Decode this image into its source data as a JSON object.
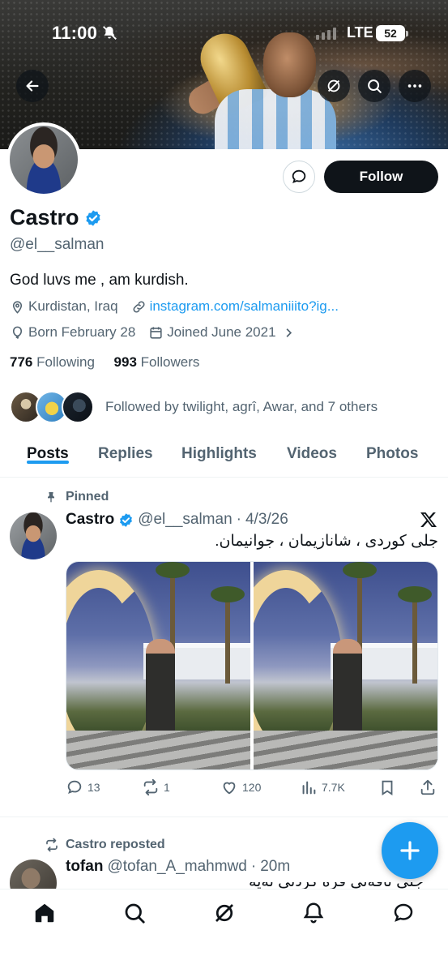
{
  "status_bar": {
    "time": "11:00",
    "network": "LTE",
    "battery": "52"
  },
  "profile": {
    "name": "Castro",
    "handle": "@el__salman",
    "bio": "God luvs me , am kurdish.",
    "location": "Kurdistan, Iraq",
    "link": "instagram.com/salmaniiito?ig...",
    "birthday": "Born February 28",
    "joined": "Joined June 2021",
    "following_count": "776",
    "following_label": "Following",
    "followers_count": "993",
    "followers_label": "Followers",
    "followed_by": "Followed by twilight, agrî, Awar, and 7 others",
    "follow_label": "Follow"
  },
  "tabs": [
    {
      "label": "Posts",
      "active": true
    },
    {
      "label": "Replies"
    },
    {
      "label": "Highlights"
    },
    {
      "label": "Videos"
    },
    {
      "label": "Photos"
    }
  ],
  "pinned_post": {
    "pinned_label": "Pinned",
    "name": "Castro",
    "handle": "@el__salman",
    "sep": "·",
    "date": "4/3/26",
    "text": "جلی کوردی ، شانازیمان ، جوانیمان.",
    "replies": "13",
    "reposts": "1",
    "likes": "120",
    "views": "7.7K"
  },
  "reposted_post": {
    "reposted_label": "Castro reposted",
    "name": "tofan",
    "handle": "@tofan_A_mahmwd",
    "sep": "·",
    "time": "20m",
    "text_clipped": "جلی تاقەتی قرە کردنی نەیە"
  },
  "colors": {
    "accent": "#1d9bf0",
    "text": "#0f1419",
    "muted": "#536471"
  },
  "icons": [
    "back-arrow-icon",
    "grok-icon",
    "search-icon",
    "more-icon",
    "message-icon",
    "verified-icon",
    "location-icon",
    "link-icon",
    "balloon-icon",
    "calendar-icon",
    "chevron-right-icon",
    "pin-icon",
    "x-logo-icon",
    "reply-icon",
    "repost-icon",
    "like-icon",
    "views-icon",
    "bookmark-icon",
    "share-icon",
    "compose-plus-icon",
    "home-icon",
    "notifications-icon",
    "messages-icon"
  ]
}
